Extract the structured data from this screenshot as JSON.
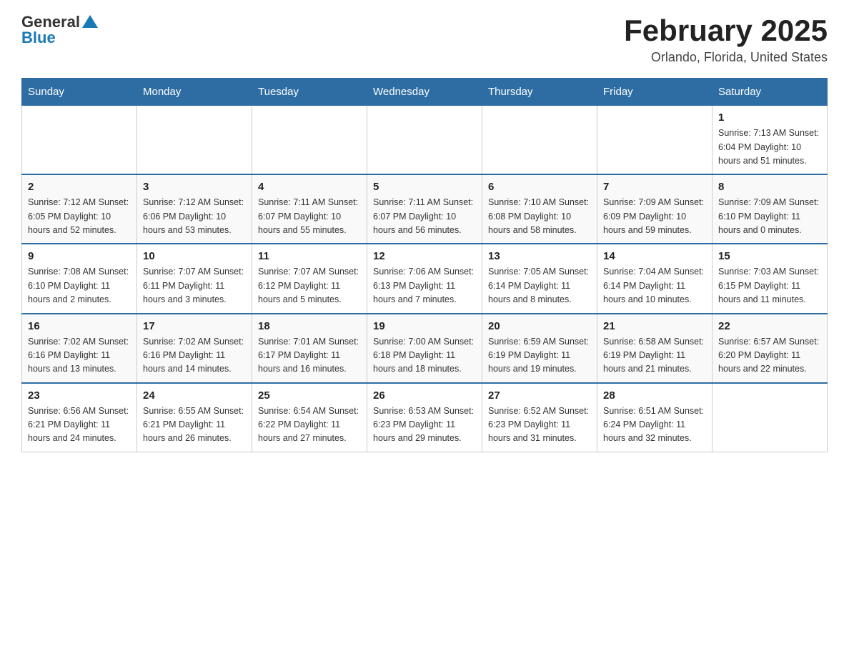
{
  "header": {
    "logo_general": "General",
    "logo_blue": "Blue",
    "month_title": "February 2025",
    "location": "Orlando, Florida, United States"
  },
  "days_of_week": [
    "Sunday",
    "Monday",
    "Tuesday",
    "Wednesday",
    "Thursday",
    "Friday",
    "Saturday"
  ],
  "weeks": [
    {
      "days": [
        {
          "num": "",
          "info": ""
        },
        {
          "num": "",
          "info": ""
        },
        {
          "num": "",
          "info": ""
        },
        {
          "num": "",
          "info": ""
        },
        {
          "num": "",
          "info": ""
        },
        {
          "num": "",
          "info": ""
        },
        {
          "num": "1",
          "info": "Sunrise: 7:13 AM\nSunset: 6:04 PM\nDaylight: 10 hours and 51 minutes."
        }
      ]
    },
    {
      "days": [
        {
          "num": "2",
          "info": "Sunrise: 7:12 AM\nSunset: 6:05 PM\nDaylight: 10 hours and 52 minutes."
        },
        {
          "num": "3",
          "info": "Sunrise: 7:12 AM\nSunset: 6:06 PM\nDaylight: 10 hours and 53 minutes."
        },
        {
          "num": "4",
          "info": "Sunrise: 7:11 AM\nSunset: 6:07 PM\nDaylight: 10 hours and 55 minutes."
        },
        {
          "num": "5",
          "info": "Sunrise: 7:11 AM\nSunset: 6:07 PM\nDaylight: 10 hours and 56 minutes."
        },
        {
          "num": "6",
          "info": "Sunrise: 7:10 AM\nSunset: 6:08 PM\nDaylight: 10 hours and 58 minutes."
        },
        {
          "num": "7",
          "info": "Sunrise: 7:09 AM\nSunset: 6:09 PM\nDaylight: 10 hours and 59 minutes."
        },
        {
          "num": "8",
          "info": "Sunrise: 7:09 AM\nSunset: 6:10 PM\nDaylight: 11 hours and 0 minutes."
        }
      ]
    },
    {
      "days": [
        {
          "num": "9",
          "info": "Sunrise: 7:08 AM\nSunset: 6:10 PM\nDaylight: 11 hours and 2 minutes."
        },
        {
          "num": "10",
          "info": "Sunrise: 7:07 AM\nSunset: 6:11 PM\nDaylight: 11 hours and 3 minutes."
        },
        {
          "num": "11",
          "info": "Sunrise: 7:07 AM\nSunset: 6:12 PM\nDaylight: 11 hours and 5 minutes."
        },
        {
          "num": "12",
          "info": "Sunrise: 7:06 AM\nSunset: 6:13 PM\nDaylight: 11 hours and 7 minutes."
        },
        {
          "num": "13",
          "info": "Sunrise: 7:05 AM\nSunset: 6:14 PM\nDaylight: 11 hours and 8 minutes."
        },
        {
          "num": "14",
          "info": "Sunrise: 7:04 AM\nSunset: 6:14 PM\nDaylight: 11 hours and 10 minutes."
        },
        {
          "num": "15",
          "info": "Sunrise: 7:03 AM\nSunset: 6:15 PM\nDaylight: 11 hours and 11 minutes."
        }
      ]
    },
    {
      "days": [
        {
          "num": "16",
          "info": "Sunrise: 7:02 AM\nSunset: 6:16 PM\nDaylight: 11 hours and 13 minutes."
        },
        {
          "num": "17",
          "info": "Sunrise: 7:02 AM\nSunset: 6:16 PM\nDaylight: 11 hours and 14 minutes."
        },
        {
          "num": "18",
          "info": "Sunrise: 7:01 AM\nSunset: 6:17 PM\nDaylight: 11 hours and 16 minutes."
        },
        {
          "num": "19",
          "info": "Sunrise: 7:00 AM\nSunset: 6:18 PM\nDaylight: 11 hours and 18 minutes."
        },
        {
          "num": "20",
          "info": "Sunrise: 6:59 AM\nSunset: 6:19 PM\nDaylight: 11 hours and 19 minutes."
        },
        {
          "num": "21",
          "info": "Sunrise: 6:58 AM\nSunset: 6:19 PM\nDaylight: 11 hours and 21 minutes."
        },
        {
          "num": "22",
          "info": "Sunrise: 6:57 AM\nSunset: 6:20 PM\nDaylight: 11 hours and 22 minutes."
        }
      ]
    },
    {
      "days": [
        {
          "num": "23",
          "info": "Sunrise: 6:56 AM\nSunset: 6:21 PM\nDaylight: 11 hours and 24 minutes."
        },
        {
          "num": "24",
          "info": "Sunrise: 6:55 AM\nSunset: 6:21 PM\nDaylight: 11 hours and 26 minutes."
        },
        {
          "num": "25",
          "info": "Sunrise: 6:54 AM\nSunset: 6:22 PM\nDaylight: 11 hours and 27 minutes."
        },
        {
          "num": "26",
          "info": "Sunrise: 6:53 AM\nSunset: 6:23 PM\nDaylight: 11 hours and 29 minutes."
        },
        {
          "num": "27",
          "info": "Sunrise: 6:52 AM\nSunset: 6:23 PM\nDaylight: 11 hours and 31 minutes."
        },
        {
          "num": "28",
          "info": "Sunrise: 6:51 AM\nSunset: 6:24 PM\nDaylight: 11 hours and 32 minutes."
        },
        {
          "num": "",
          "info": ""
        }
      ]
    }
  ]
}
